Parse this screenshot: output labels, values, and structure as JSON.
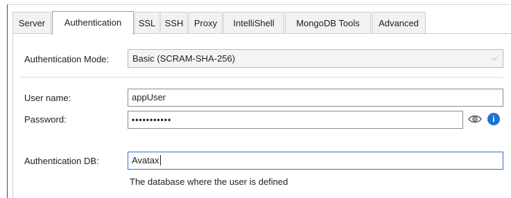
{
  "tabs": [
    {
      "label": "Server"
    },
    {
      "label": "Authentication",
      "active": true
    },
    {
      "label": "SSL"
    },
    {
      "label": "SSH"
    },
    {
      "label": "Proxy"
    },
    {
      "label": "IntelliShell"
    },
    {
      "label": "MongoDB Tools"
    },
    {
      "label": "Advanced"
    }
  ],
  "form": {
    "auth_mode_label": "Authentication Mode:",
    "auth_mode_value": "Basic (SCRAM-SHA-256)",
    "username_label": "User name:",
    "username_value": "appUser",
    "password_label": "Password:",
    "password_value": "•••••••••••",
    "auth_db_label": "Authentication DB:",
    "auth_db_value": "Avatax",
    "auth_db_hint": "The database where the user is defined"
  },
  "icons": {
    "dropdown": "chevron-down-icon",
    "show_password": "eye-icon",
    "info": "info-icon"
  },
  "colors": {
    "info_accent": "#1b73d6"
  }
}
